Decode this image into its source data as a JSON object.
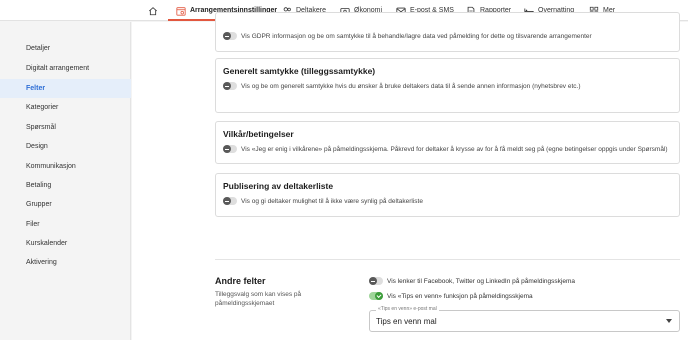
{
  "nav": {
    "home_icon": "home-icon",
    "items": [
      {
        "label": "Arrangementsinnstillinger",
        "icon": "calendar-gear-icon",
        "active": true
      },
      {
        "label": "Deltakere",
        "icon": "users-icon"
      },
      {
        "label": "Økonomi",
        "icon": "money-icon"
      },
      {
        "label": "E-post & SMS",
        "icon": "envelope-icon"
      },
      {
        "label": "Rapporter",
        "icon": "report-icon"
      },
      {
        "label": "Overnatting",
        "icon": "bed-icon"
      },
      {
        "label": "Mer",
        "icon": "grid-icon"
      }
    ],
    "accent": "#e2573f"
  },
  "sidebar": {
    "items": [
      {
        "label": "Detaljer"
      },
      {
        "label": "Digitalt arrangement"
      },
      {
        "label": "Felter",
        "active": true
      },
      {
        "label": "Kategorier"
      },
      {
        "label": "Spørsmål"
      },
      {
        "label": "Design"
      },
      {
        "label": "Kommunikasjon"
      },
      {
        "label": "Betaling"
      },
      {
        "label": "Grupper"
      },
      {
        "label": "Filer"
      },
      {
        "label": "Kurskalender"
      },
      {
        "label": "Aktivering"
      }
    ],
    "active_color": "#2f6fd6"
  },
  "cards": {
    "gdpr": {
      "toggle_text": "Vis GDPR informasjon og be om samtykke til å behandle/lagre data ved påmelding for dette og tilsvarende arrangementer",
      "on": false
    },
    "consent": {
      "title": "Generelt samtykke (tilleggssamtykke)",
      "toggle_text": "Vis og be om generelt samtykke hvis du ønsker å bruke deltakers data til å sende annen informasjon (nyhetsbrev etc.)",
      "on": false
    },
    "terms": {
      "title": "Vilkår/betingelser",
      "toggle_text": "Vis «Jeg er enig i vilkårene» på påmeldingsskjema. Påkrevd for deltaker å krysse av for å få meldt seg på (egne betingelser oppgis under Spørsmål)",
      "on": false
    },
    "publish": {
      "title": "Publisering av deltakerliste",
      "toggle_text": "Vis og gi deltaker mulighet til å ikke være synlig på deltakerliste",
      "on": false
    }
  },
  "other": {
    "title": "Andre felter",
    "description": "Tilleggsvalg som kan vises på påmeldingsskjemaet",
    "toggles": [
      {
        "label": "Vis lenker til Facebook, Twitter og LinkedIn på påmeldingsskjema",
        "on": false
      },
      {
        "label": "Vis «Tips en venn» funksjon på påmeldingsskjema",
        "on": true
      }
    ],
    "select": {
      "label": "«Tips en venn» e-post mal",
      "value": "Tips en venn mal"
    }
  }
}
